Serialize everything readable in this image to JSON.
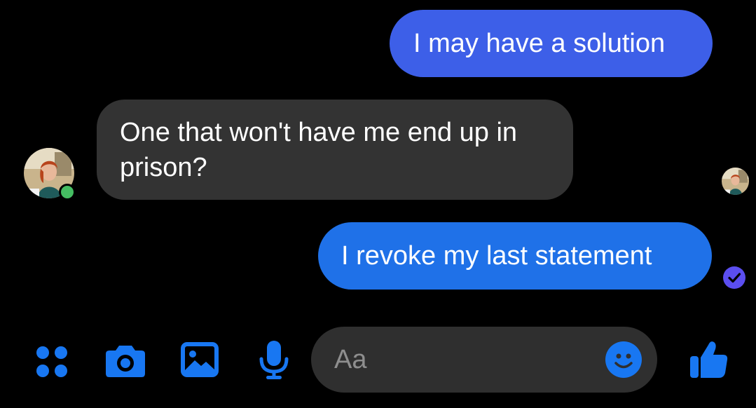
{
  "messages": [
    {
      "direction": "outgoing",
      "text": "I may have a solution"
    },
    {
      "direction": "incoming",
      "text": "One that won't have me end up in prison?"
    },
    {
      "direction": "outgoing",
      "text": "I revoke my last statement"
    }
  ],
  "contact": {
    "online": true,
    "avatar_icon": "user-avatar-icon"
  },
  "read_receipt_icon": "seen-avatar-icon",
  "sent_status_icon": "sent-check-icon",
  "composer": {
    "placeholder": "Aa",
    "value": "",
    "emoji_icon": "emoji-icon",
    "like_icon": "thumbs-up-icon"
  },
  "toolbar": {
    "icons": [
      "apps-grid-icon",
      "camera-icon",
      "image-icon",
      "microphone-icon"
    ]
  },
  "colors": {
    "background": "#000000",
    "outgoing_bubble_1": "#3d5fe8",
    "outgoing_bubble_2": "#1f71e8",
    "incoming_bubble": "#333333",
    "accent": "#1877f2",
    "online": "#45bd62",
    "sent_check": "#5b4ef0"
  }
}
